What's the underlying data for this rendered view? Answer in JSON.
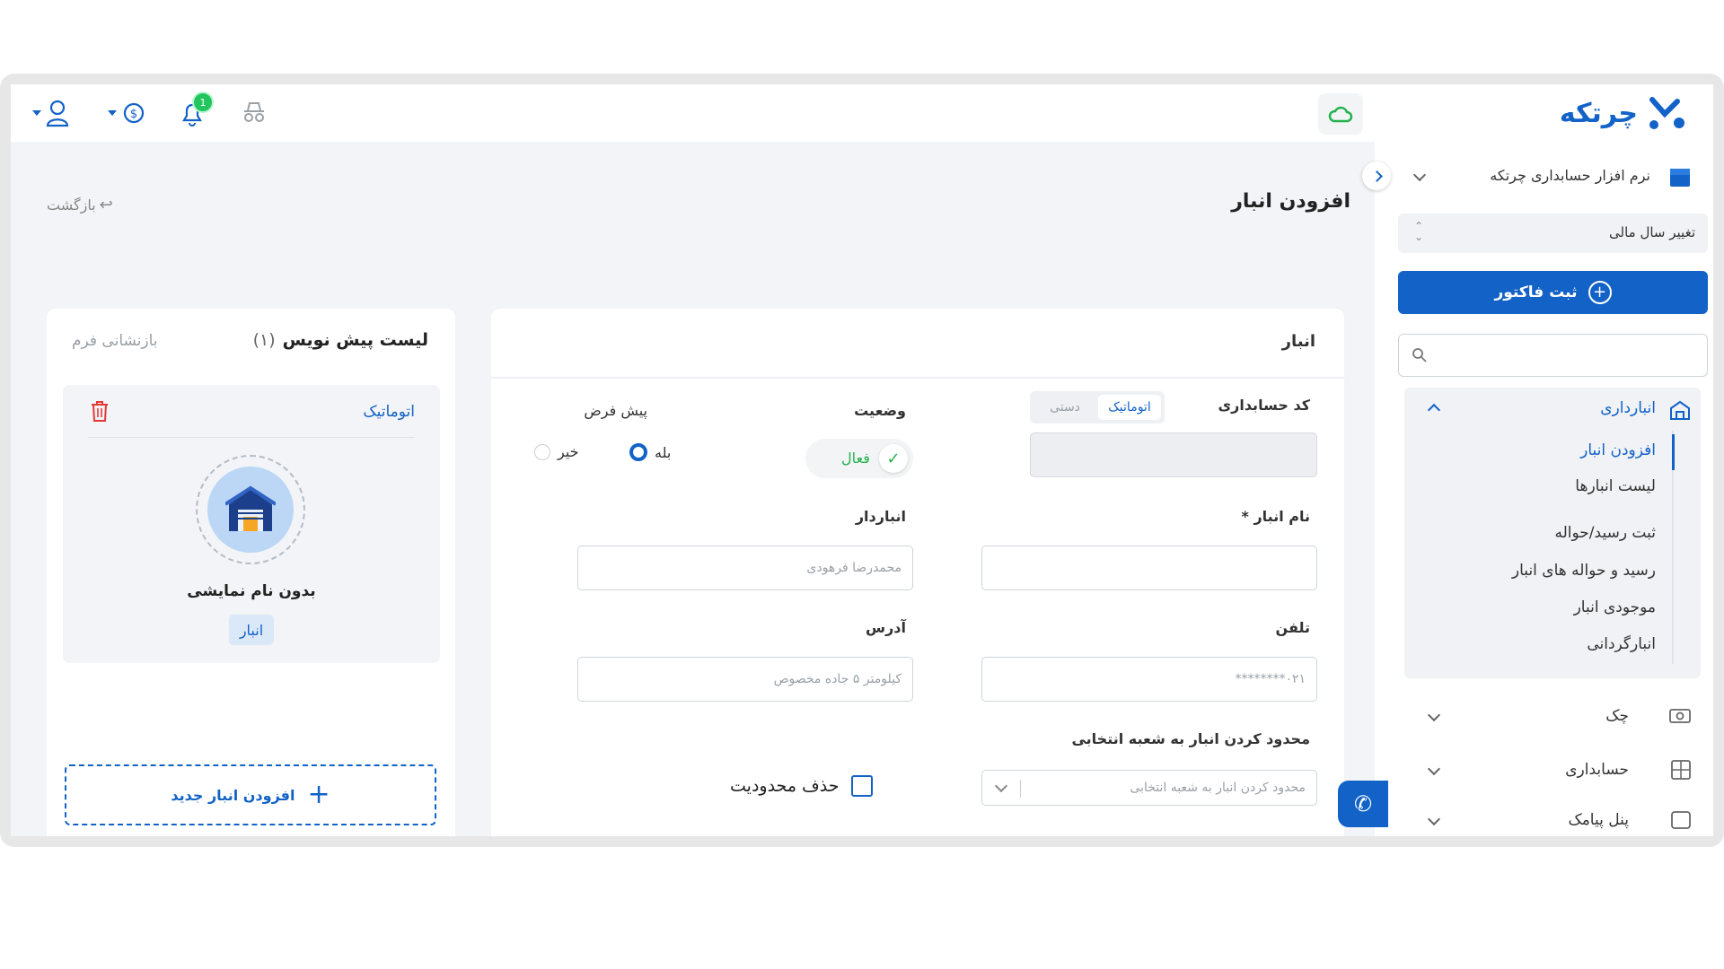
{
  "app": {
    "logo_text": "چرتکه"
  },
  "sidebar": {
    "company": "نرم افزار حسابداری چرتکه",
    "fiscal_year": "تغییر سال مالی",
    "invoice_button": "ثبت فاکتور",
    "search_placeholder": "",
    "warehouse_section": "انبارداری",
    "sub_items": [
      "افزودن انبار",
      "لیست انبارها",
      "ثبت رسید/حواله",
      "رسید و حواله های انبار",
      "موجودی انبار",
      "انبارگردانی"
    ],
    "cheque": "چک",
    "accounting": "حسابداری",
    "partial_item": "پنل پیامک"
  },
  "topbar": {
    "notification_count": "1"
  },
  "page": {
    "title": "افزودن انبار",
    "back_label": "بازگشت"
  },
  "form": {
    "section_title": "انبار",
    "accounting_code_label": "کد حسابداری",
    "toggle_auto": "اتوماتیک",
    "toggle_manual": "دستی",
    "status_label": "وضعیت",
    "status_value": "فعال",
    "default_label": "پیش فرض",
    "yes": "بله",
    "no": "خیر",
    "name_label": "نام انبار *",
    "keeper_label": "انباردار",
    "keeper_placeholder": "محمدرضا فرهودی",
    "phone_label": "تلفن",
    "phone_placeholder": "۰۲۱********",
    "address_label": "آدرس",
    "address_placeholder": "کیلومتر ۵ جاده مخصوص",
    "branch_label": "محدود کردن انبار به شعبه انتخابی",
    "branch_placeholder": "محدود کردن انبار به شعبه انتخابی",
    "remove_limit": "حذف محدودیت"
  },
  "draft": {
    "title": "لیست پیش نویس",
    "count": "(۱)",
    "reset": "بازنشانی فرم",
    "item_code": "اتوماتیک",
    "item_name": "بدون نام نمایشی",
    "item_tag": "انبار",
    "add_new": "افزودن انبار جدید"
  },
  "colors": {
    "primary": "#1262c7",
    "success": "#22b14c",
    "danger": "#e53935"
  }
}
